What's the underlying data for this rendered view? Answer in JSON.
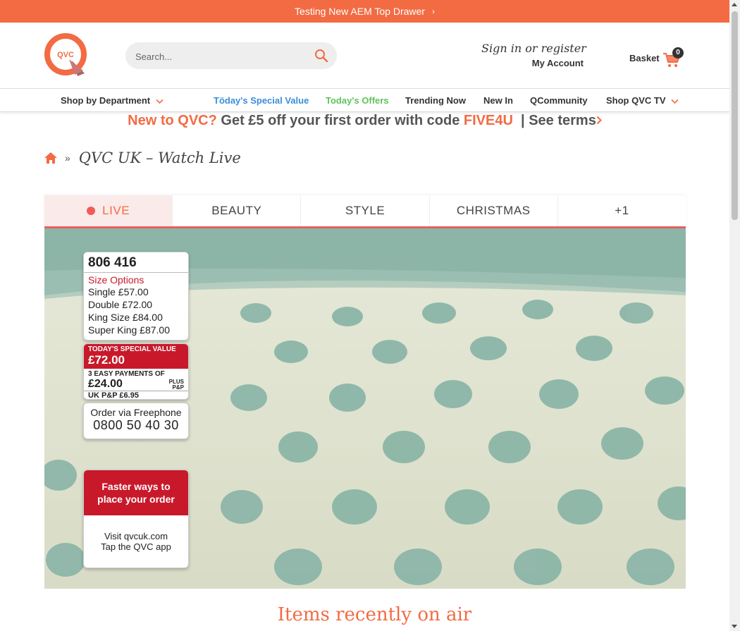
{
  "topbar": {
    "text": "Testing New AEM Top Drawer",
    "chevron": "›"
  },
  "header": {
    "logo_text": "QVC",
    "search_placeholder": "Search...",
    "signin": "Sign in or register",
    "my_account": "My Account",
    "basket_label": "Basket",
    "basket_count": "0"
  },
  "nav": {
    "department": "Shop by Department",
    "special_value": "Töday's Special Value",
    "offers": "Today's Offers",
    "trending": "Trending Now",
    "new_in": "New In",
    "qcommunity": "QCommunity",
    "shop_tv": "Shop QVC TV"
  },
  "promo": {
    "new_to": "New to QVC?",
    "get": "Get £5 off your first order with code",
    "code": "FIVE4U",
    "terms": "| See terms"
  },
  "breadcrumb": {
    "sep": "»",
    "title": "QVC UK – Watch Live"
  },
  "tabs": [
    "LIVE",
    "BEAUTY",
    "STYLE",
    "CHRISTMAS",
    "+1"
  ],
  "video": {
    "item_number": "806 416",
    "size_options": "Size Options",
    "sizes": [
      "Single £57.00",
      "Double £72.00",
      "King Size £84.00",
      "Super King £87.00"
    ],
    "tsv_label": "TODAY'S SPECIAL VALUE",
    "tsv_price": "£72.00",
    "easy_pay": "3 EASY PAYMENTS OF",
    "easy_amount": "£24.00",
    "plus": "PLUS",
    "pp_short": "P&P",
    "uk_pp": "UK P&P £6.95",
    "order_via": "Order via Freephone",
    "phone": "0800 50 40 30",
    "faster": "Faster ways to place your order",
    "visit": "Visit qvcuk.com",
    "app": "Tap the QVC app"
  },
  "recent_title": "Items recently on air",
  "colors": {
    "accent": "#f26b43",
    "blue": "#3b8ed8",
    "green": "#5fc35a",
    "live": "#f25a5a",
    "tsv_red": "#c8192b"
  }
}
